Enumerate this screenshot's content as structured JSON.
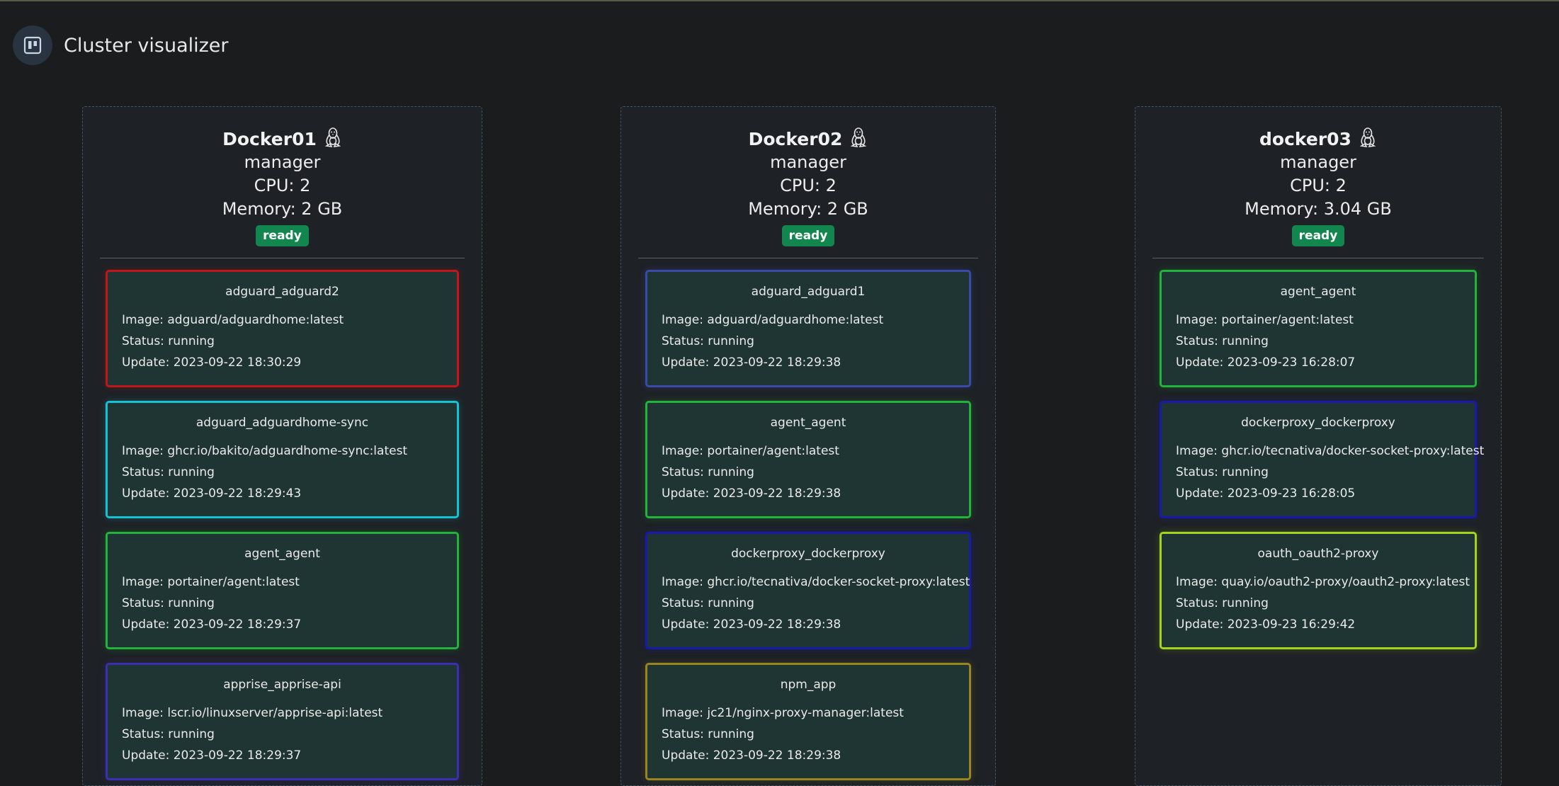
{
  "header": {
    "title": "Cluster visualizer",
    "icon": "board-icon"
  },
  "colors": {
    "background": "#1b1c1e",
    "node_bg": "#1e2226",
    "card_bg": "#1f3533",
    "ready_badge": "#13864f"
  },
  "nodes": [
    {
      "name": "Docker01",
      "os_icon": "linux-icon",
      "role": "manager",
      "cpu": "CPU: 2",
      "memory": "Memory: 2 GB",
      "status": "ready",
      "services": [
        {
          "name": "adguard_adguard2",
          "image": "Image: adguard/adguardhome:latest",
          "status": "Status: running",
          "update": "Update: 2023-09-22 18:30:29",
          "color": "#c0161c"
        },
        {
          "name": "adguard_adguardhome-sync",
          "image": "Image: ghcr.io/bakito/adguardhome-sync:latest",
          "status": "Status: running",
          "update": "Update: 2023-09-22 18:29:43",
          "color": "#14c2d6"
        },
        {
          "name": "agent_agent",
          "image": "Image: portainer/agent:latest",
          "status": "Status: running",
          "update": "Update: 2023-09-22 18:29:37",
          "color": "#22b33a"
        },
        {
          "name": "apprise_apprise-api",
          "image": "Image: lscr.io/linuxserver/apprise-api:latest",
          "status": "Status: running",
          "update": "Update: 2023-09-22 18:29:37",
          "color": "#3a2fb0"
        }
      ]
    },
    {
      "name": "Docker02",
      "os_icon": "linux-icon",
      "role": "manager",
      "cpu": "CPU: 2",
      "memory": "Memory: 2 GB",
      "status": "ready",
      "services": [
        {
          "name": "adguard_adguard1",
          "image": "Image: adguard/adguardhome:latest",
          "status": "Status: running",
          "update": "Update: 2023-09-22 18:29:38",
          "color": "#3a4aa8"
        },
        {
          "name": "agent_agent",
          "image": "Image: portainer/agent:latest",
          "status": "Status: running",
          "update": "Update: 2023-09-22 18:29:38",
          "color": "#22b33a"
        },
        {
          "name": "dockerproxy_dockerproxy",
          "image": "Image: ghcr.io/tecnativa/docker-socket-proxy:latest",
          "status": "Status: running",
          "update": "Update: 2023-09-22 18:29:38",
          "color": "#1a1aa8"
        },
        {
          "name": "npm_app",
          "image": "Image: jc21/nginx-proxy-manager:latest",
          "status": "Status: running",
          "update": "Update: 2023-09-22 18:29:38",
          "color": "#9a8420"
        }
      ]
    },
    {
      "name": "docker03",
      "os_icon": "linux-icon",
      "role": "manager",
      "cpu": "CPU: 2",
      "memory": "Memory: 3.04 GB",
      "status": "ready",
      "services": [
        {
          "name": "agent_agent",
          "image": "Image: portainer/agent:latest",
          "status": "Status: running",
          "update": "Update: 2023-09-23 16:28:07",
          "color": "#22b33a"
        },
        {
          "name": "dockerproxy_dockerproxy",
          "image": "Image: ghcr.io/tecnativa/docker-socket-proxy:latest",
          "status": "Status: running",
          "update": "Update: 2023-09-23 16:28:05",
          "color": "#1a1aa8"
        },
        {
          "name": "oauth_oauth2-proxy",
          "image": "Image: quay.io/oauth2-proxy/oauth2-proxy:latest",
          "status": "Status: running",
          "update": "Update: 2023-09-23 16:29:42",
          "color": "#a6d418"
        }
      ]
    }
  ]
}
